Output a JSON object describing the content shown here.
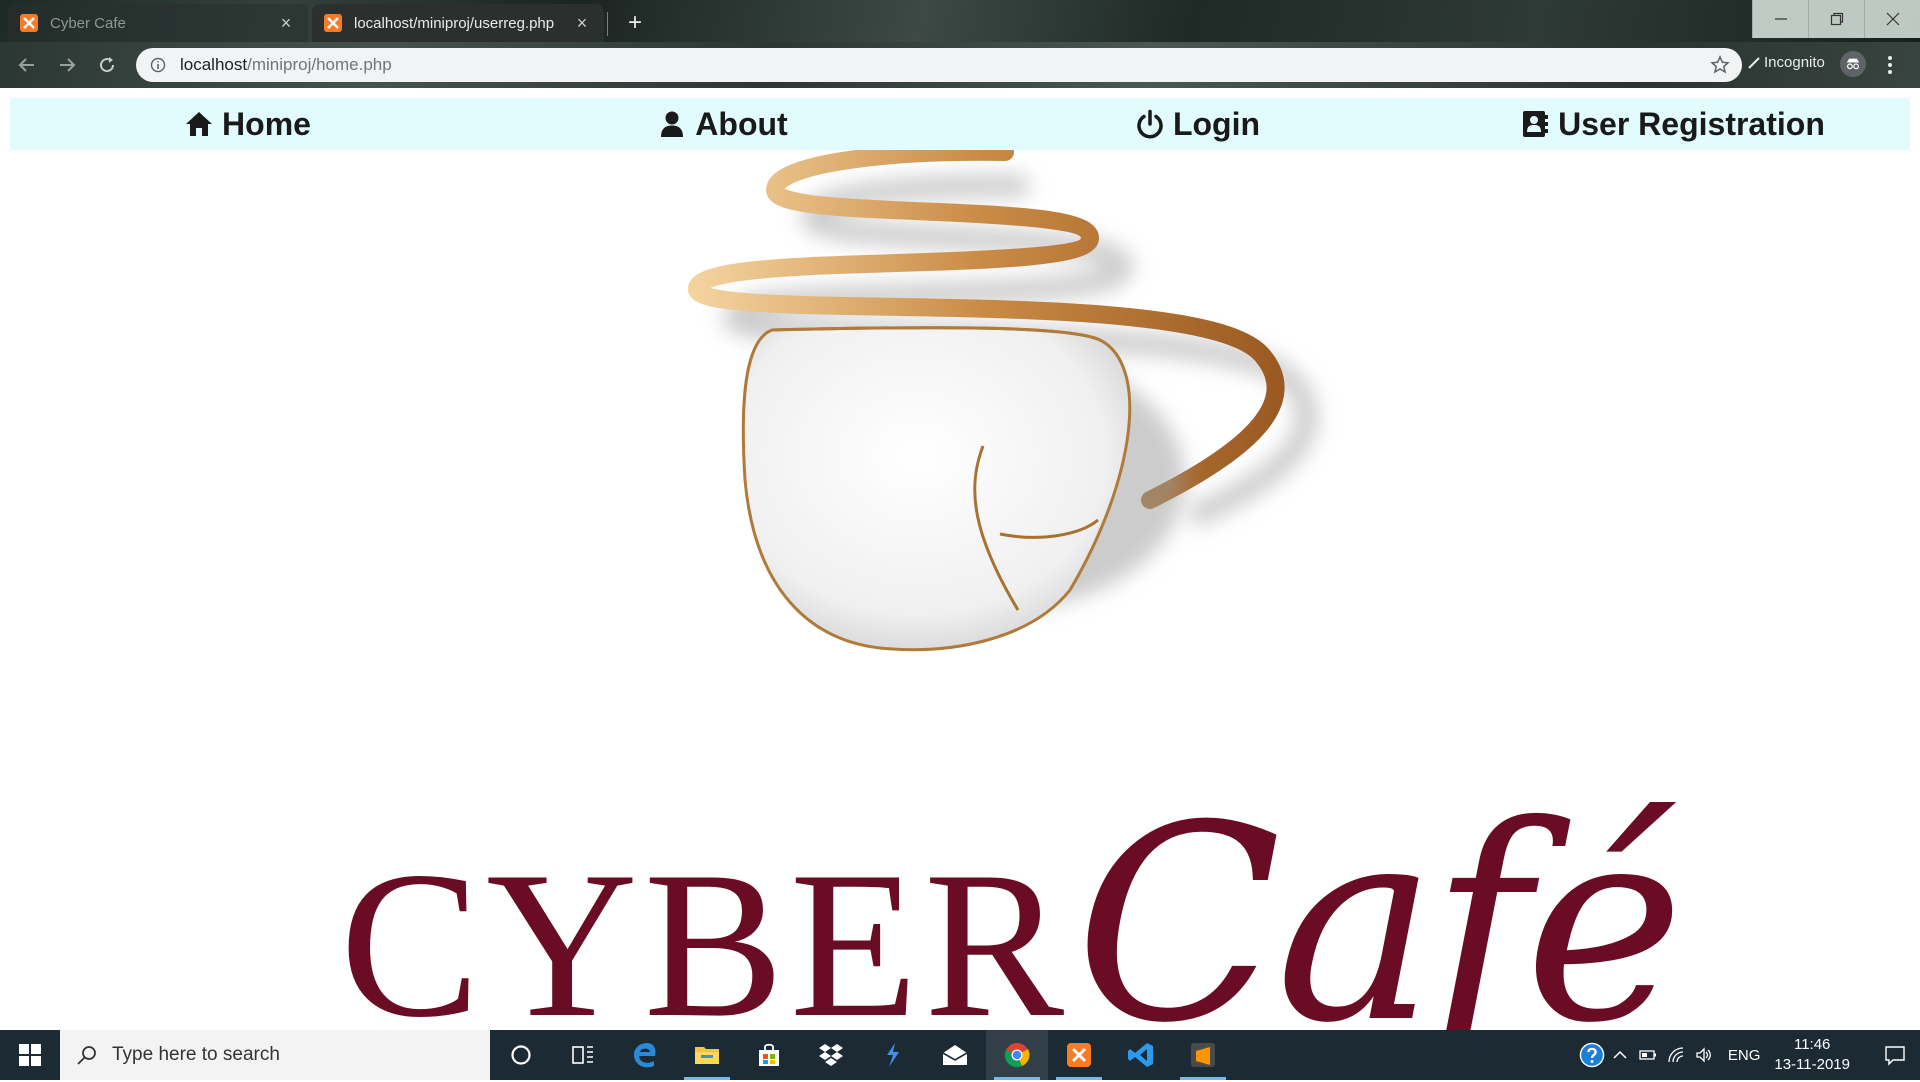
{
  "browser": {
    "tabs": [
      {
        "title": "Cyber Cafe",
        "active": false,
        "icon": "xampp-icon"
      },
      {
        "title": "localhost/miniproj/userreg.php",
        "active": true,
        "icon": "xampp-icon"
      }
    ],
    "new_tab": "+",
    "url_host": "localhost",
    "url_path": "/miniproj/home.php",
    "incognito_label": "Incognito"
  },
  "site_nav": {
    "items": [
      {
        "label": "Home",
        "icon": "home-icon"
      },
      {
        "label": "About",
        "icon": "user-icon"
      },
      {
        "label": "Login",
        "icon": "power-icon"
      },
      {
        "label": "User Registration",
        "icon": "contact-card-icon"
      }
    ]
  },
  "logo": {
    "word": "CYBER",
    "script": "Café",
    "color": "#6a0d24",
    "steam_color": "#b8763a"
  },
  "taskbar": {
    "search_placeholder": "Type here to search",
    "apps": [
      "cortana-icon",
      "task-view-icon",
      "edge-icon",
      "file-explorer-icon",
      "store-icon",
      "dropbox-icon",
      "visual-studio-icon",
      "mail-icon",
      "chrome-icon",
      "xampp-icon",
      "vscode-icon",
      "sublime-icon"
    ],
    "language": "ENG",
    "time": "11:46",
    "date": "13-11-2019"
  },
  "colors": {
    "nav_bg": "#e2fbfd",
    "taskbar_bg": "#1c2a33"
  }
}
